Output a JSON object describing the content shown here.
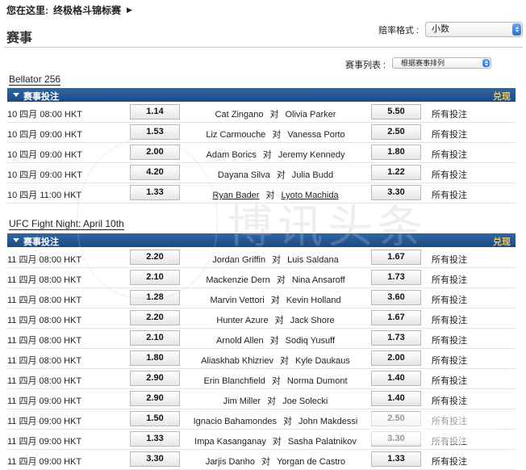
{
  "breadcrumb": {
    "label": "您在这里:",
    "link": "终极格斗锦标赛"
  },
  "page_title": "赛事",
  "odds_format": {
    "label": "赔率格式 :",
    "selected": "小数"
  },
  "event_list": {
    "label": "赛事列表 :",
    "selected": "根据赛事排列"
  },
  "common": {
    "vs": "对",
    "all_bets": "所有投注",
    "section_label": "赛事投注",
    "redeem": "兑现"
  },
  "colors": {
    "section_bar": "#1f5190",
    "redeem": "#f2c94c"
  },
  "sections": [
    {
      "title": "Bellator 256",
      "events": [
        {
          "time": "10 四月 08:00 HKT",
          "home": "Cat Zingano",
          "away": "Olivia Parker",
          "home_odds": "1.14",
          "away_odds": "5.50"
        },
        {
          "time": "10 四月 09:00 HKT",
          "home": "Liz Carmouche",
          "away": "Vanessa Porto",
          "home_odds": "1.53",
          "away_odds": "2.50"
        },
        {
          "time": "10 四月 09:00 HKT",
          "home": "Adam Borics",
          "away": "Jeremy Kennedy",
          "home_odds": "2.00",
          "away_odds": "1.80"
        },
        {
          "time": "10 四月 09:00 HKT",
          "home": "Dayana Silva",
          "away": "Julia Budd",
          "home_odds": "4.20",
          "away_odds": "1.22"
        },
        {
          "time": "10 四月 11:00 HKT",
          "home": "Ryan Bader",
          "away": "Lyoto Machida",
          "home_odds": "1.33",
          "away_odds": "3.30"
        }
      ]
    },
    {
      "title": "UFC Fight Night: April 10th",
      "events": [
        {
          "time": "11 四月 08:00 HKT",
          "home": "Jordan Griffin",
          "away": "Luis Saldana",
          "home_odds": "2.20",
          "away_odds": "1.67"
        },
        {
          "time": "11 四月 08:00 HKT",
          "home": "Mackenzie Dern",
          "away": "Nina Ansaroff",
          "home_odds": "2.10",
          "away_odds": "1.73"
        },
        {
          "time": "11 四月 08:00 HKT",
          "home": "Marvin Vettori",
          "away": "Kevin Holland",
          "home_odds": "1.28",
          "away_odds": "3.60"
        },
        {
          "time": "11 四月 08:00 HKT",
          "home": "Hunter Azure",
          "away": "Jack Shore",
          "home_odds": "2.20",
          "away_odds": "1.67"
        },
        {
          "time": "11 四月 08:00 HKT",
          "home": "Arnold Allen",
          "away": "Sodiq Yusuff",
          "home_odds": "2.10",
          "away_odds": "1.73"
        },
        {
          "time": "11 四月 08:00 HKT",
          "home": "Aliaskhab Khizriev",
          "away": "Kyle Daukaus",
          "home_odds": "1.80",
          "away_odds": "2.00"
        },
        {
          "time": "11 四月 08:00 HKT",
          "home": "Erin Blanchfield",
          "away": "Norma Dumont",
          "home_odds": "2.90",
          "away_odds": "1.40"
        },
        {
          "time": "11 四月 09:00 HKT",
          "home": "Jim Miller",
          "away": "Joe Solecki",
          "home_odds": "2.90",
          "away_odds": "1.40"
        },
        {
          "time": "11 四月 09:00 HKT",
          "home": "Ignacio Bahamondes",
          "away": "John Makdessi",
          "home_odds": "1.50",
          "away_odds": "2.50"
        },
        {
          "time": "11 四月 09:00 HKT",
          "home": "Impa Kasanganay",
          "away": "Sasha Palatnikov",
          "home_odds": "1.33",
          "away_odds": "3.30"
        },
        {
          "time": "11 四月 09:00 HKT",
          "home": "Jarjis Danho",
          "away": "Yorgan de Castro",
          "home_odds": "3.30",
          "away_odds": "1.33"
        }
      ]
    }
  ]
}
